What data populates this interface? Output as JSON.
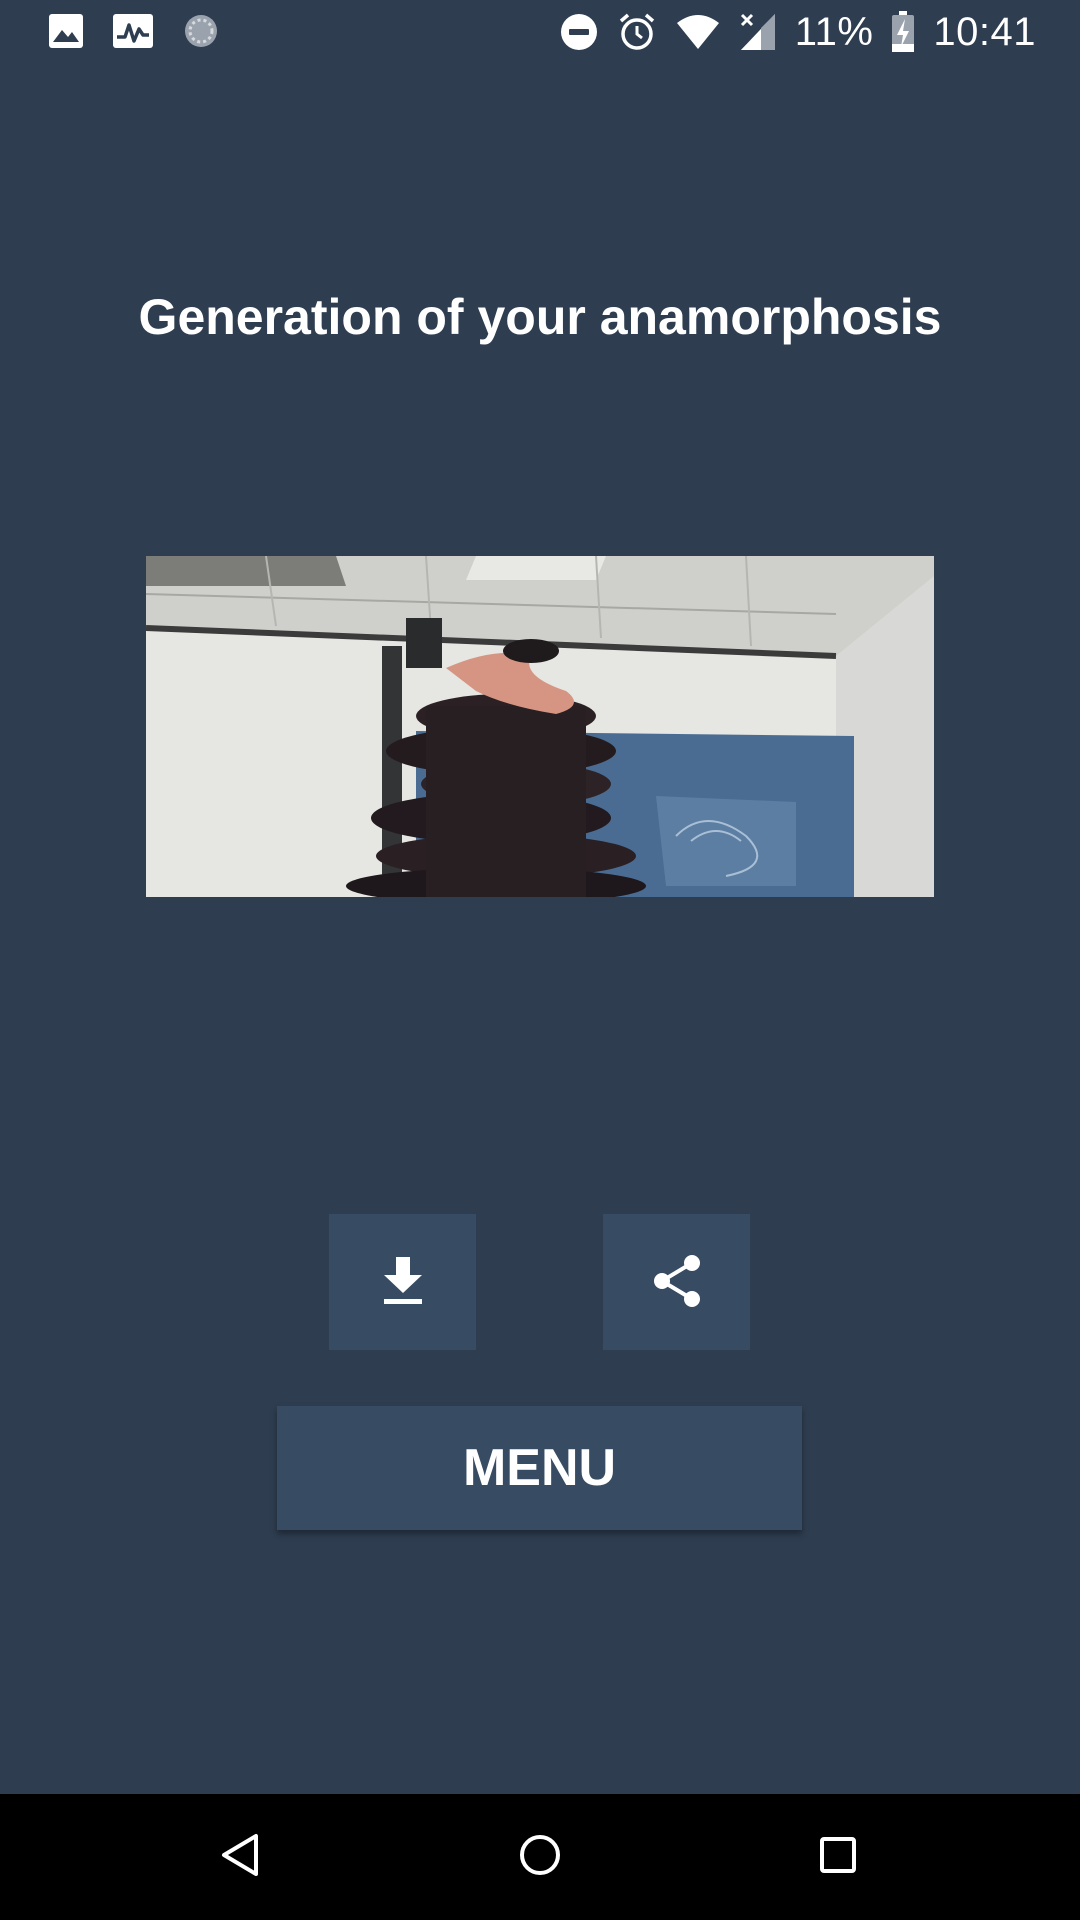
{
  "status_bar": {
    "left_icons": [
      "gallery-icon",
      "activity-icon",
      "loading-icon"
    ],
    "right_icons": [
      "do-not-disturb-icon",
      "alarm-icon",
      "wifi-icon",
      "cell-signal-icon",
      "battery-charging-icon"
    ],
    "battery": "11%",
    "time": "10:41"
  },
  "main": {
    "title": "Generation of your anamorphosis",
    "download_icon": "download-icon",
    "share_icon": "share-icon",
    "menu_label": "MENU"
  },
  "nav_bar": {
    "icons": [
      "back-icon",
      "home-icon",
      "recents-icon"
    ]
  },
  "colors": {
    "background": "#2e3d50",
    "button": "#374b62",
    "text": "#ffffff",
    "nav_background": "#000000"
  }
}
